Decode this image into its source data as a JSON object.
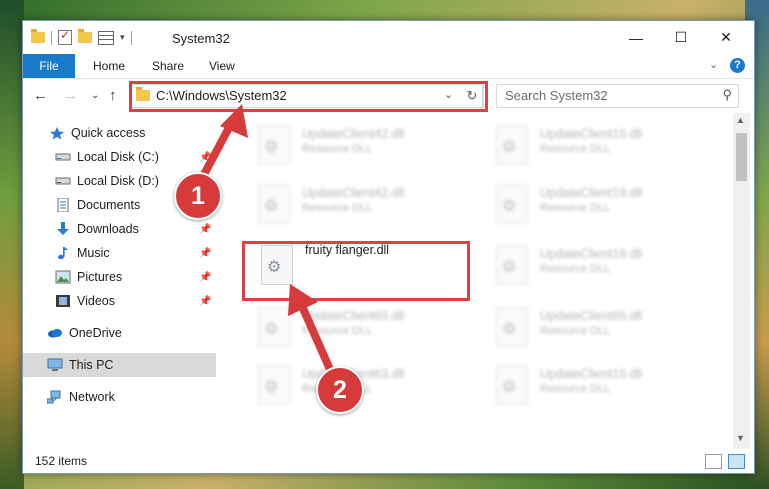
{
  "window": {
    "title": "System32"
  },
  "titlebar": {
    "minimize": "—",
    "maximize": "☐",
    "close": "✕"
  },
  "ribbon": {
    "tabs": [
      "File",
      "Home",
      "Share",
      "View"
    ],
    "help": "?"
  },
  "address": {
    "path": "C:\\Windows\\System32",
    "search_placeholder": "Search System32"
  },
  "nav": {
    "items": [
      {
        "label": "Quick access",
        "icon": "star-icon"
      },
      {
        "label": "Local Disk (C:)",
        "icon": "drive-icon",
        "pinned": true
      },
      {
        "label": "Local Disk (D:)",
        "icon": "drive-icon",
        "pinned": true
      },
      {
        "label": "Documents",
        "icon": "documents-icon",
        "pinned": true
      },
      {
        "label": "Downloads",
        "icon": "downloads-icon",
        "pinned": true
      },
      {
        "label": "Music",
        "icon": "music-icon",
        "pinned": true
      },
      {
        "label": "Pictures",
        "icon": "pictures-icon",
        "pinned": true
      },
      {
        "label": "Videos",
        "icon": "videos-icon",
        "pinned": true
      },
      {
        "label": "OneDrive",
        "icon": "cloud-icon"
      },
      {
        "label": "This PC",
        "icon": "computer-icon",
        "selected": true
      },
      {
        "label": "Network",
        "icon": "network-icon"
      }
    ]
  },
  "files": [
    {
      "name": "UpdateClient42.dll",
      "type": "Resource DLL"
    },
    {
      "name": "UpdateClient15.dll",
      "type": "Resource DLL"
    },
    {
      "name": "UpdateClient42.dll",
      "type": "Resource DLL"
    },
    {
      "name": "UpdateClient19.dll",
      "type": "Resource DLL"
    },
    {
      "name": "fruity flanger.dll",
      "type": ""
    },
    {
      "name": "UpdateClient19.dll",
      "type": "Resource DLL"
    },
    {
      "name": "UpdateClient65.dll",
      "type": "Resource DLL"
    },
    {
      "name": "UpdateClient65.dll",
      "type": "Resource DLL"
    },
    {
      "name": "UpdateClient63.dll",
      "type": "Resource DLL"
    },
    {
      "name": "UpdateClient15.dll",
      "type": "Resource DLL"
    }
  ],
  "status": {
    "count": "152 items"
  },
  "callouts": {
    "one": "1",
    "two": "2"
  },
  "colors": {
    "accent": "#1979ca",
    "highlight": "#d94343"
  }
}
